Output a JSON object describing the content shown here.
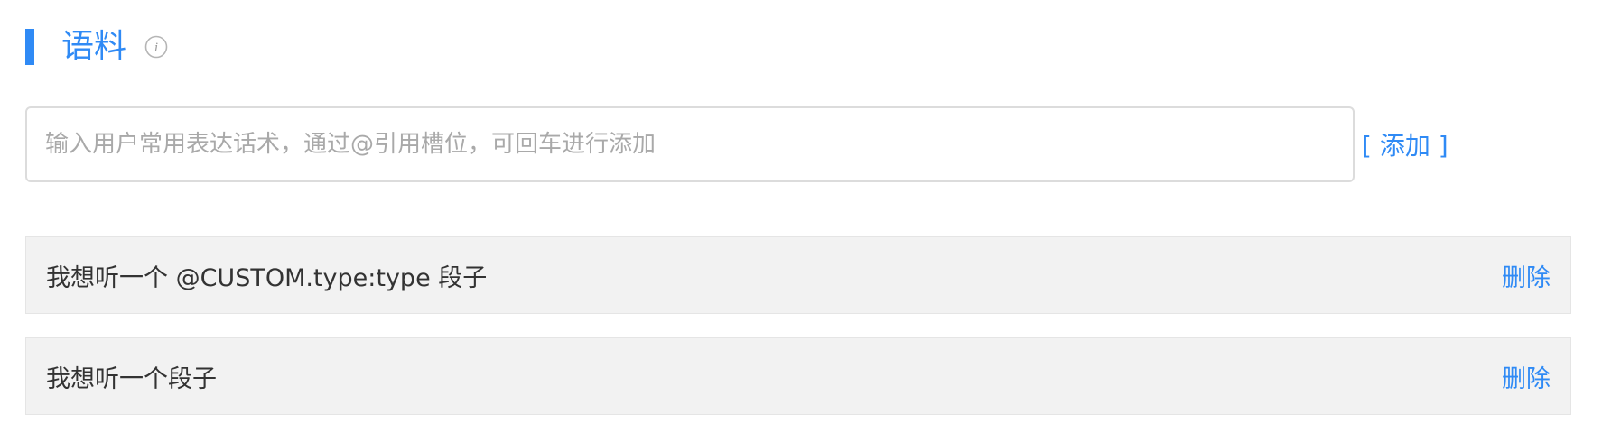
{
  "section": {
    "title": "语料"
  },
  "input": {
    "placeholder": "输入用户常用表达话术，通过@引用槽位，可回车进行添加",
    "value": "",
    "add_label": "[ 添加 ]"
  },
  "items": [
    {
      "text": "我想听一个 @CUSTOM.type:type 段子",
      "delete_label": "删除"
    },
    {
      "text": "我想听一个段子",
      "delete_label": "删除"
    }
  ],
  "colors": {
    "accent": "#2f8af5",
    "item_background": "#f2f2f2"
  },
  "icons": {
    "info": "info-icon"
  }
}
